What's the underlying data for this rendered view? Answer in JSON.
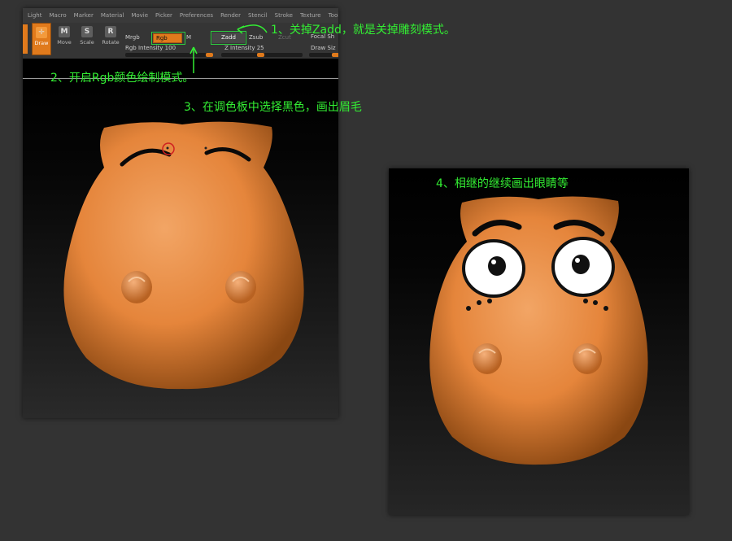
{
  "menu": [
    "Light",
    "Macro",
    "Marker",
    "Material",
    "Movie",
    "Picker",
    "Preferences",
    "Render",
    "Stencil",
    "Stroke",
    "Texture",
    "Tool",
    "T"
  ],
  "toolbar": {
    "draw": "Draw",
    "move": "Move",
    "scale": "Scale",
    "rotate": "Rotate",
    "mrgb": "Mrgb",
    "rgb": "Rgb",
    "m": "M",
    "zadd": "Zadd",
    "zsub": "Zsub",
    "zcut": "Zcut",
    "focal": "Focal Sh",
    "rgb_intensity": "Rgb Intensity 100",
    "z_intensity": "Z Intensity 25",
    "draw_size": "Draw Siz"
  },
  "annotations": {
    "step1": "1、关掉Zadd，就是关掉雕刻模式。",
    "step2": "2、开启Rgb颜色绘制模式。",
    "step3": "3、在调色板中选择黑色，画出眉毛",
    "step4": "4、相继的继续画出眼睛等"
  },
  "colors": {
    "accent": "#e07a1c",
    "annotation": "#33ee33",
    "model": "#e8893f"
  }
}
